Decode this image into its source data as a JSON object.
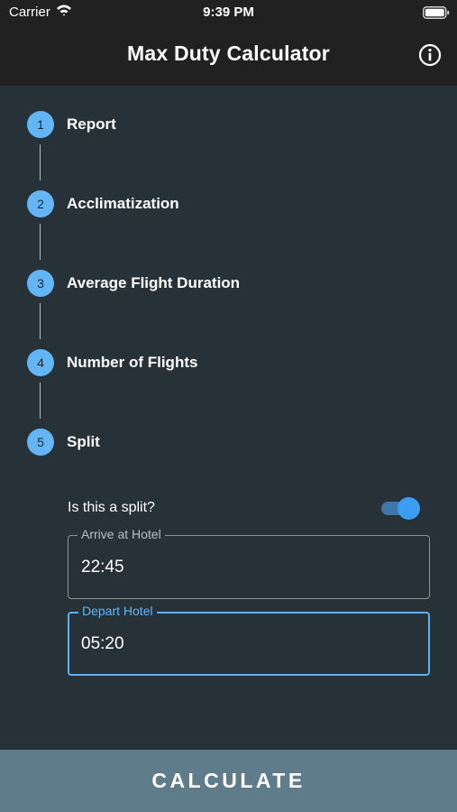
{
  "status_bar": {
    "carrier": "Carrier",
    "time": "9:39 PM"
  },
  "app_bar": {
    "title": "Max Duty Calculator",
    "info_icon": "info-icon"
  },
  "steps": [
    {
      "number": "1",
      "label": "Report"
    },
    {
      "number": "2",
      "label": "Acclimatization"
    },
    {
      "number": "3",
      "label": "Average Flight Duration"
    },
    {
      "number": "4",
      "label": "Number of Flights"
    },
    {
      "number": "5",
      "label": "Split"
    }
  ],
  "split": {
    "question": "Is this a split?",
    "enabled": true,
    "arrive": {
      "label": "Arrive at Hotel",
      "value": "22:45"
    },
    "depart": {
      "label": "Depart Hotel",
      "value": "05:20"
    }
  },
  "calculate_label": "CALCULATE",
  "colors": {
    "accent": "#64b5f6",
    "background": "#263238",
    "appbar": "#212121",
    "button": "#5f7c8b"
  }
}
